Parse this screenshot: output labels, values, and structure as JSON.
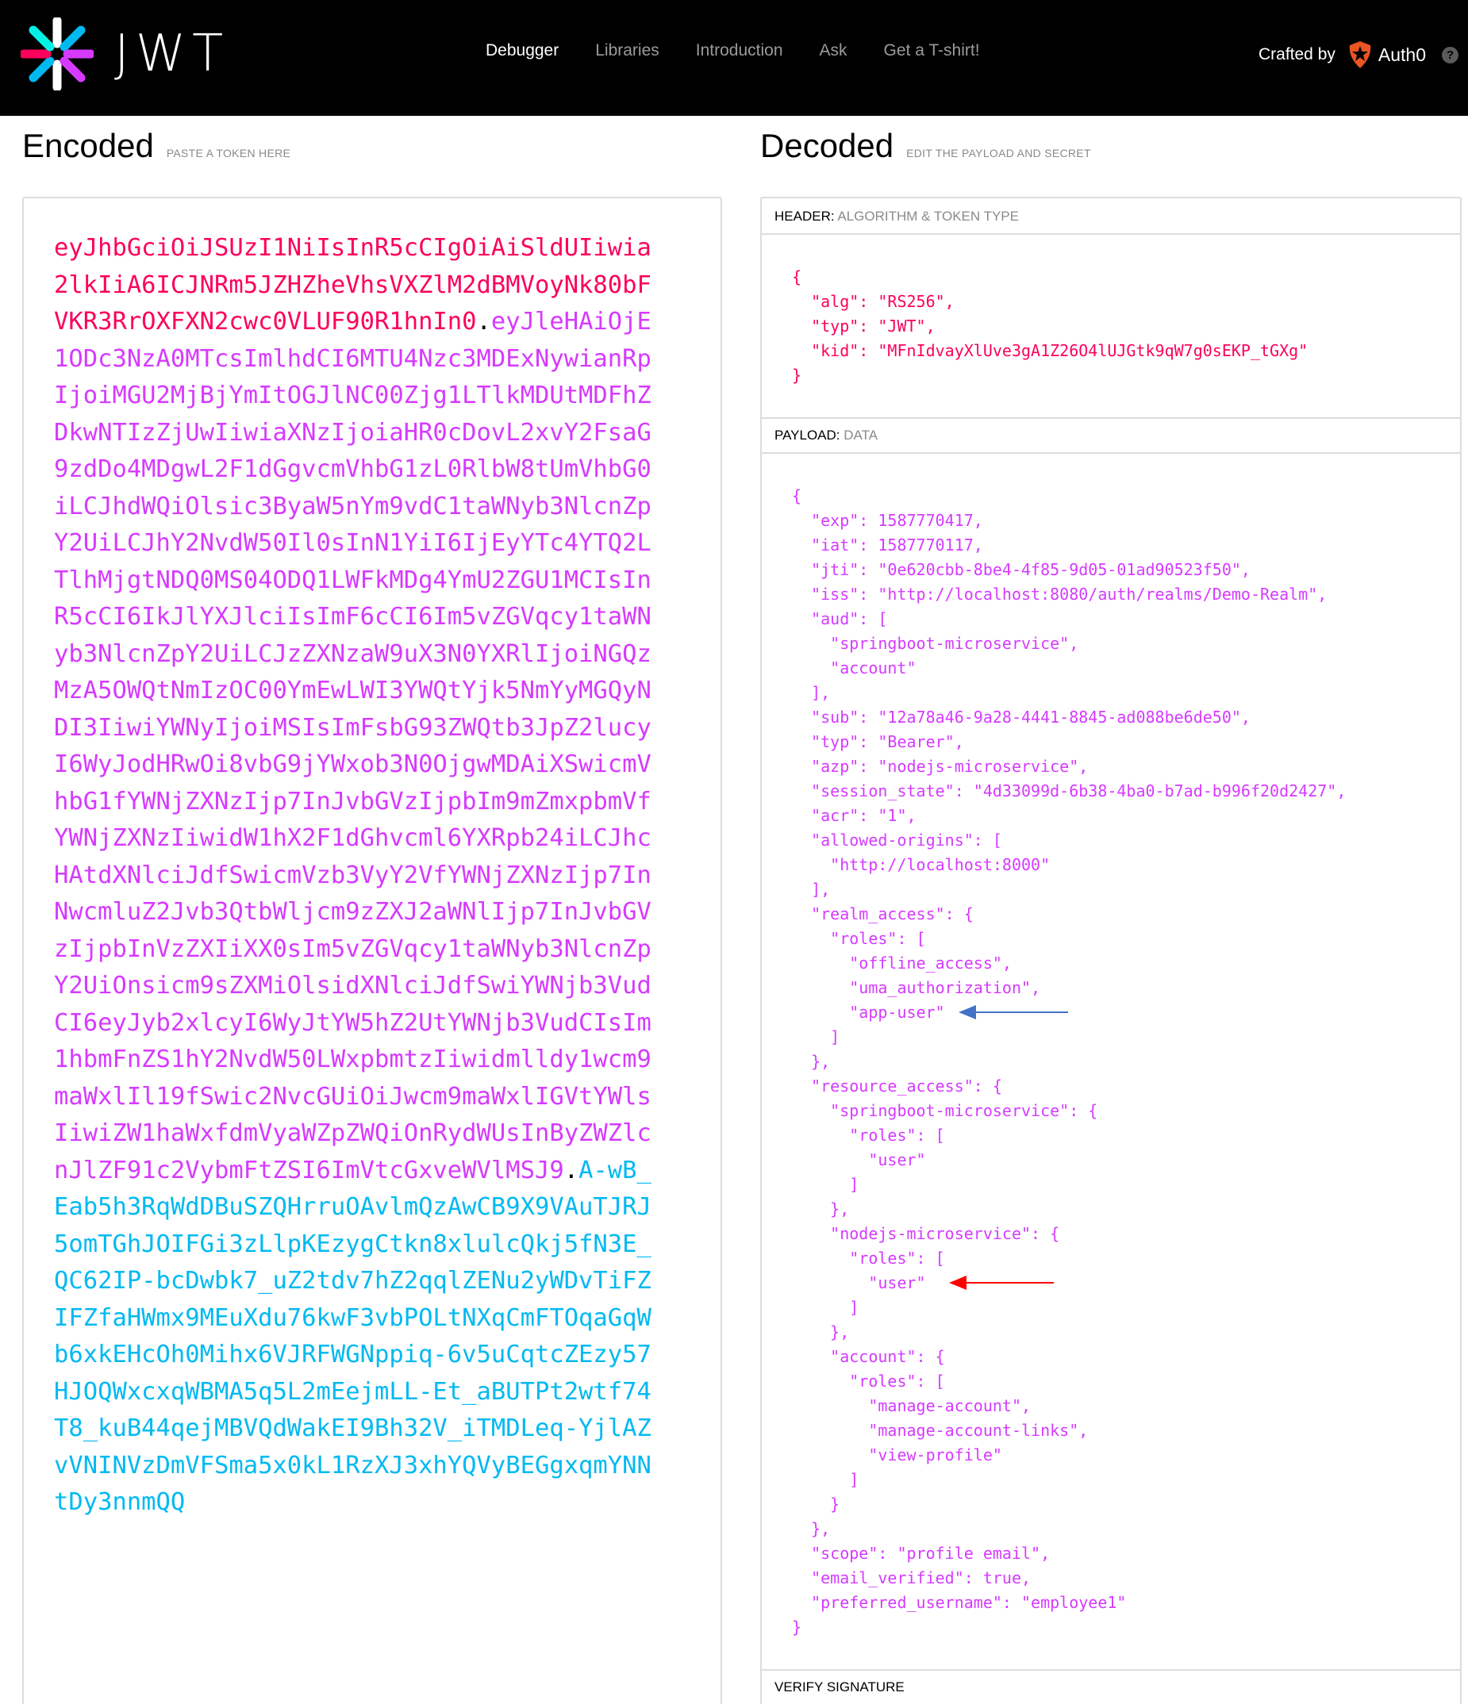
{
  "nav": {
    "logo_text": "JWT",
    "links": [
      "Debugger",
      "Libraries",
      "Introduction",
      "Ask",
      "Get a T-shirt!"
    ],
    "active_index": 0,
    "crafted_by": "Crafted by",
    "brand": "Auth0",
    "help": "?"
  },
  "encoded": {
    "title": "Encoded",
    "subtitle": "PASTE A TOKEN HERE",
    "token_header": "eyJhbGciOiJSUzI1NiIsInR5cCIgOiAiSldUIiwia2lkIiA6ICJNRm5JZHZheVhsVXZlM2dBMVoyNk80bFVKR3RrOXFXN2cwc0VLUF90R1hnIn0",
    "token_payload": "eyJleHAiOjE1ODc3NzA0MTcsImlhdCI6MTU4Nzc3MDExNywianRpIjoiMGU2MjBjYmItOGJlNC00Zjg1LTlkMDUtMDFhZDkwNTIzZjUwIiwiaXNzIjoiaHR0cDovL2xvY2FsaG9zdDo4MDgwL2F1dGgvcmVhbG1zL0RlbW8tUmVhbG0iLCJhdWQiOlsic3ByaW5nYm9vdC1taWNyb3NlcnZpY2UiLCJhY2NvdW50Il0sInN1YiI6IjEyYTc4YTQ2LTlhMjgtNDQ0MS04ODQ1LWFkMDg4YmU2ZGU1MCIsInR5cCI6IkJlYXJlciIsImF6cCI6Im5vZGVqcy1taWNyb3NlcnZpY2UiLCJzZXNzaW9uX3N0YXRlIjoiNGQzMzA5OWQtNmIzOC00YmEwLWI3YWQtYjk5NmYyMGQyNDI3IiwiYWNyIjoiMSIsImFsbG93ZWQtb3JpZ2lucyI6WyJodHRwOi8vbG9jYWxob3N0OjgwMDAiXSwicmVhbG1fYWNjZXNzIjp7InJvbGVzIjpbIm9mZmxpbmVfYWNjZXNzIiwidW1hX2F1dGhvcml6YXRpb24iLCJhcHAtdXNlciJdfSwicmVzb3VyY2VfYWNjZXNzIjp7InNwcmluZ2Jvb3QtbWljcm9zZXJ2aWNlIjp7InJvbGVzIjpbInVzZXIiXX0sIm5vZGVqcy1taWNyb3NlcnZpY2UiOnsicm9sZXMiOlsidXNlciJdfSwiYWNjb3VudCI6eyJyb2xlcyI6WyJtYW5hZ2UtYWNjb3VudCIsIm1hbmFnZS1hY2NvdW50LWxpbmtzIiwidmlldy1wcm9maWxlIl19fSwic2NvcGUiOiJwcm9maWxlIGVtYWlsIiwiZW1haWxfdmVyaWZpZWQiOnRydWUsInByZWZlcnJlZF91c2VybmFtZSI6ImVtcGxveWVlMSJ9",
    "token_signature": "A-wB_Eab5h3RqWdDBuSZQHrruOAvlmQzAwCB9X9VAuTJRJ5omTGhJOIFGi3zLlpKEzygCtkn8xlulcQkj5fN3E_QC62IP-bcDwbk7_uZ2tdv7hZ2qqlZENu2yWDvTiFZIFZfaHWmx9MEuXdu76kwF3vbPOLtNXqCmFTOqaGqWb6xkEHcOh0Mihx6VJRFWGNppiq-6v5uCqtcZEzy57HJOQWxcxqWBMA5q5L2mEejmLL-Et_aBUTPt2wtf74T8_kuB44qejMBVQdWakEI9Bh32V_iTMDLeq-YjlAZvVNINVzDmVFSma5x0kL1RzXJ3xhYQVyBEGgxqmYNNtDy3nnmQQ"
  },
  "decoded": {
    "title": "Decoded",
    "subtitle": "EDIT THE PAYLOAD AND SECRET",
    "header_label": "HEADER:",
    "header_desc": "ALGORITHM & TOKEN TYPE",
    "payload_label": "PAYLOAD:",
    "payload_desc": "DATA",
    "verify_label": "VERIFY SIGNATURE",
    "header_json": [
      "{",
      "  \"alg\": \"RS256\",",
      "  \"typ\": \"JWT\",",
      "  \"kid\": \"MFnIdvayXlUve3gA1Z26O4lUJGtk9qW7g0sEKP_tGXg\"",
      "}"
    ],
    "payload_json": [
      "{",
      "  \"exp\": 1587770417,",
      "  \"iat\": 1587770117,",
      "  \"jti\": \"0e620cbb-8be4-4f85-9d05-01ad90523f50\",",
      "  \"iss\": \"http://localhost:8080/auth/realms/Demo-Realm\",",
      "  \"aud\": [",
      "    \"springboot-microservice\",",
      "    \"account\"",
      "  ],",
      "  \"sub\": \"12a78a46-9a28-4441-8845-ad088be6de50\",",
      "  \"typ\": \"Bearer\",",
      "  \"azp\": \"nodejs-microservice\",",
      "  \"session_state\": \"4d33099d-6b38-4ba0-b7ad-b996f20d2427\",",
      "  \"acr\": \"1\",",
      "  \"allowed-origins\": [",
      "    \"http://localhost:8000\"",
      "  ],",
      "  \"realm_access\": {",
      "    \"roles\": [",
      "      \"offline_access\",",
      "      \"uma_authorization\",",
      "      \"app-user\"",
      "    ]",
      "  },",
      "  \"resource_access\": {",
      "    \"springboot-microservice\": {",
      "      \"roles\": [",
      "        \"user\"",
      "      ]",
      "    },",
      "    \"nodejs-microservice\": {",
      "      \"roles\": [",
      "        \"user\"",
      "      ]",
      "    },",
      "    \"account\": {",
      "      \"roles\": [",
      "        \"manage-account\",",
      "        \"manage-account-links\",",
      "        \"view-profile\"",
      "      ]",
      "    }",
      "  },",
      "  \"scope\": \"profile email\",",
      "  \"email_verified\": true,",
      "  \"preferred_username\": \"employee1\"",
      "}"
    ],
    "colors": {
      "header": "#fb015b",
      "payload": "#d63aff",
      "signature": "#00b9f1",
      "blue_arrow": "#4472c4",
      "red_arrow": "#ff0000"
    }
  }
}
